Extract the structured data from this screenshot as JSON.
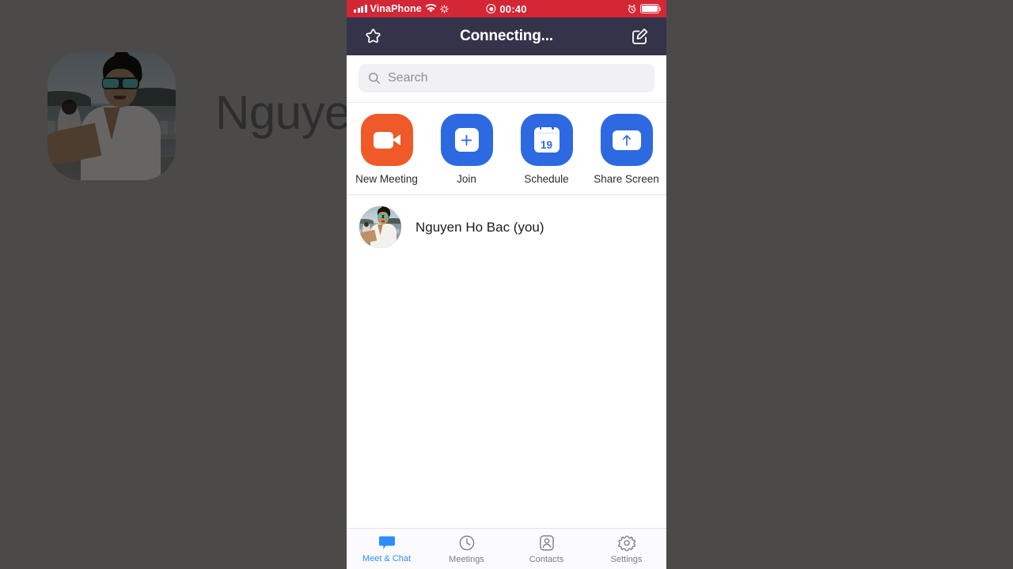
{
  "background": {
    "overlay_name_text": "Nguye",
    "dim_color": "#4c4a49",
    "avatar_alt": "profile-photo-man-sunglasses-beach"
  },
  "status_bar": {
    "carrier": "VinaPhone",
    "wifi_icon": "wifi-icon",
    "activity_icon": "activity-spinner-icon",
    "signal_icon": "signal-bars-icon",
    "recording_icon": "recording-indicator-icon",
    "time": "00:40",
    "alarm_icon": "alarm-clock-icon",
    "battery_icon": "battery-icon",
    "background_color": "#d32736",
    "text_color": "#ffffff"
  },
  "nav_bar": {
    "title": "Connecting...",
    "left_icon": "star-icon",
    "right_icon": "compose-icon",
    "background_color": "#353349"
  },
  "search": {
    "placeholder": "Search",
    "icon": "search-icon"
  },
  "actions": [
    {
      "label": "New Meeting",
      "icon": "video-camera-icon",
      "color": "#f05a28"
    },
    {
      "label": "Join",
      "icon": "plus-icon",
      "color": "#2d69e1"
    },
    {
      "label": "Schedule",
      "icon": "calendar-icon",
      "color": "#2d69e1",
      "day": "19"
    },
    {
      "label": "Share Screen",
      "icon": "up-arrow-icon",
      "color": "#2d69e1"
    }
  ],
  "contacts": [
    {
      "name": "Nguyen Ho Bac (you)",
      "avatar": "user-avatar"
    }
  ],
  "tabs": [
    {
      "label": "Meet & Chat",
      "icon": "chat-bubble-icon",
      "active": true
    },
    {
      "label": "Meetings",
      "icon": "clock-icon",
      "active": false
    },
    {
      "label": "Contacts",
      "icon": "person-icon",
      "active": false
    },
    {
      "label": "Settings",
      "icon": "gear-icon",
      "active": false
    }
  ],
  "theme": {
    "accent": "#2d8cff",
    "orange": "#f05a28",
    "blue": "#2d69e1",
    "inactive": "#7c7c81"
  }
}
